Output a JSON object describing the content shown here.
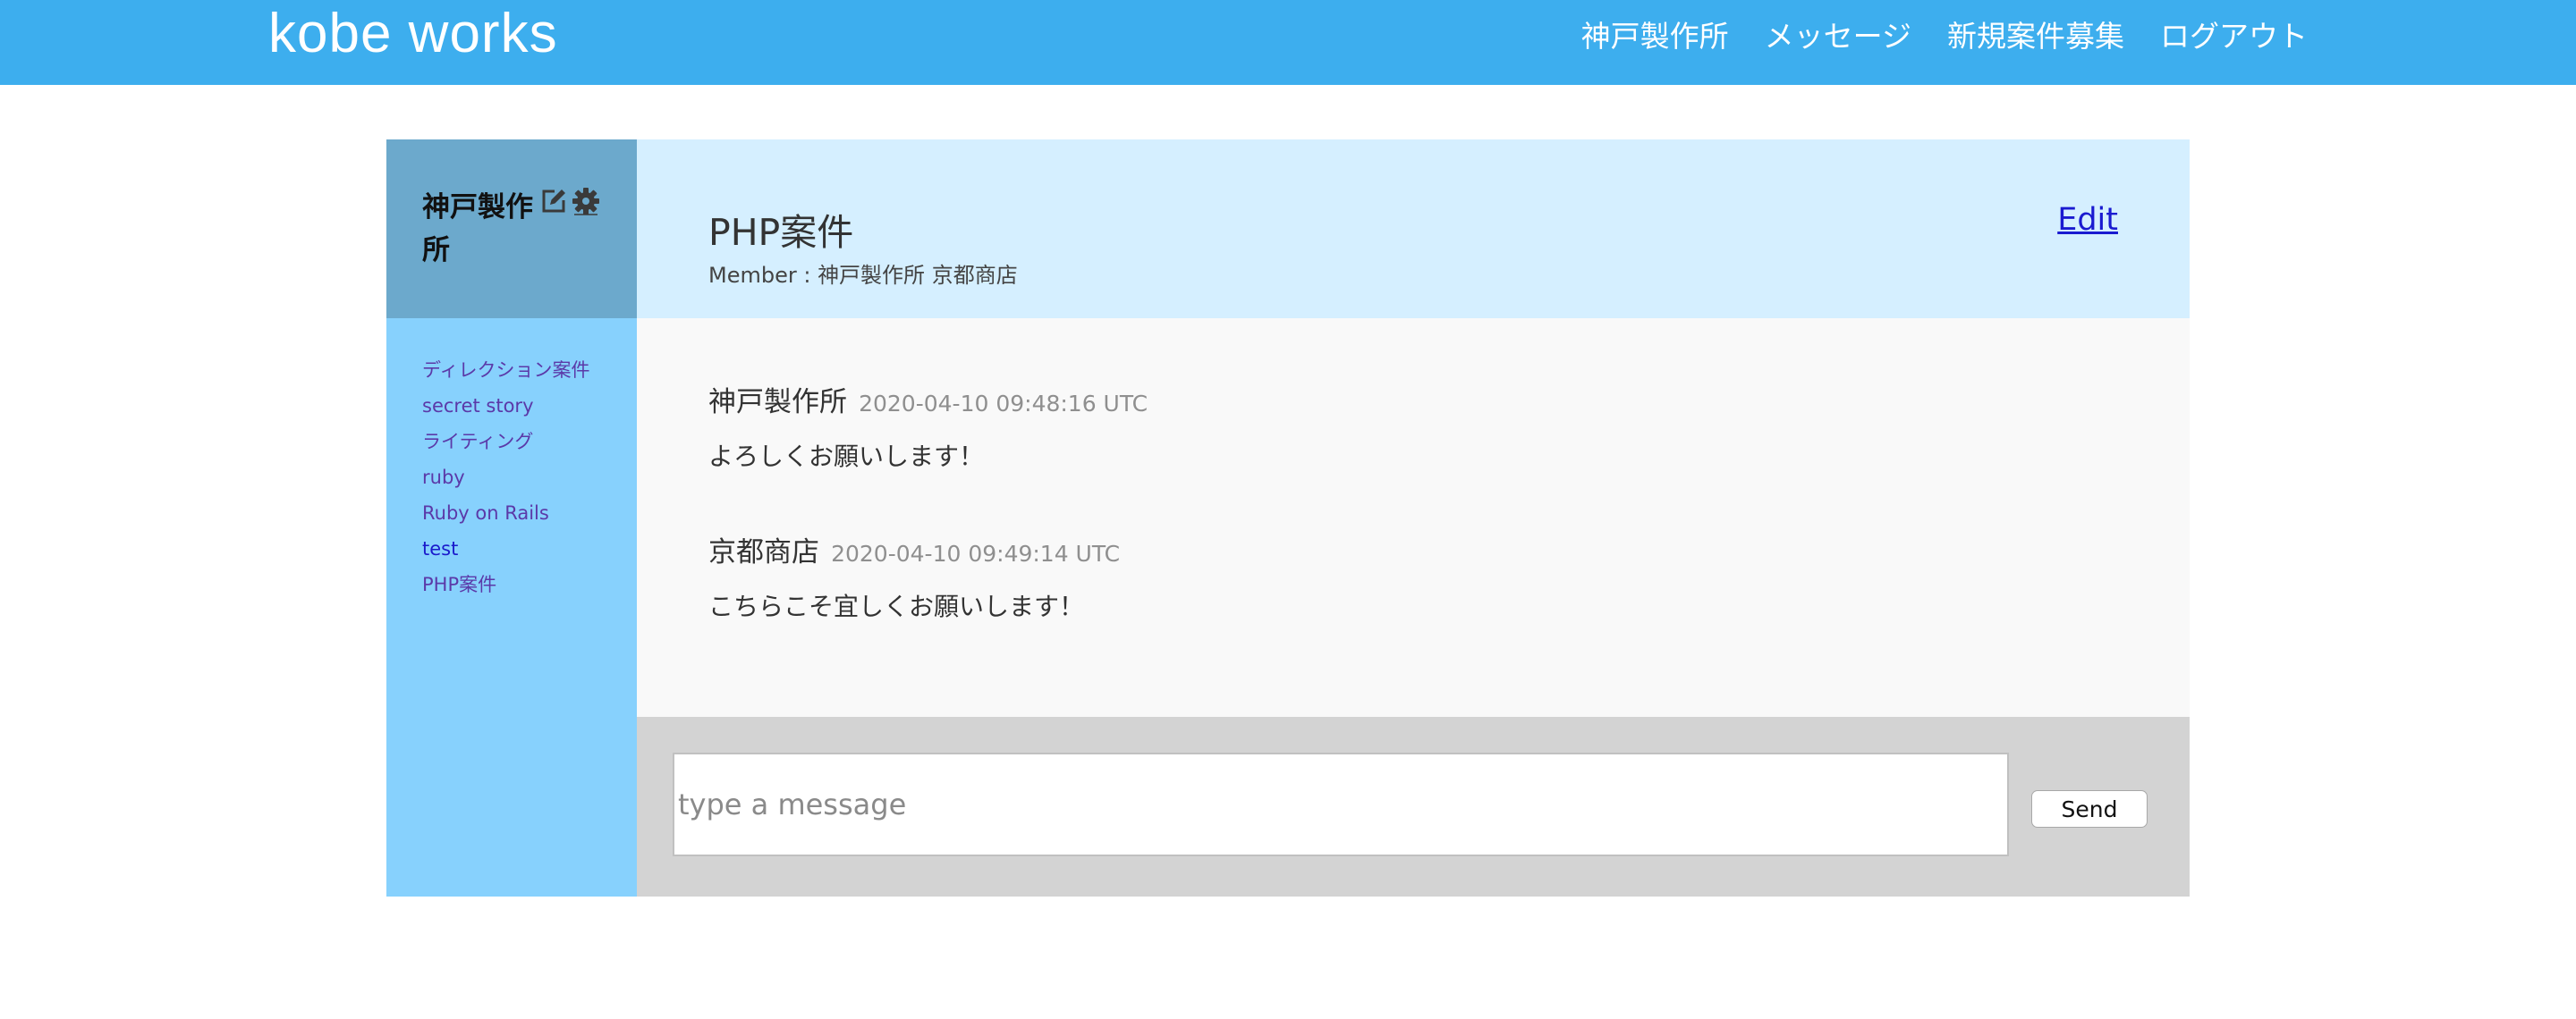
{
  "navbar": {
    "brand": "kobe works",
    "links": [
      "神戸製作所",
      "メッセージ",
      "新規案件募集",
      "ログアウト"
    ],
    "background": "#3daeee"
  },
  "sidebar": {
    "company_name": "神戸製作所",
    "icons": [
      "edit-icon",
      "gear-icon"
    ],
    "rooms": [
      "ディレクション案件",
      "secret story",
      "ライティング",
      "ruby",
      "Ruby on Rails",
      "test",
      "PHP案件"
    ],
    "active_room": "test"
  },
  "room": {
    "title": "PHP案件",
    "members": "Member : 神戸製作所 京都商店",
    "edit_label": "Edit"
  },
  "messages": [
    {
      "author": "神戸製作所",
      "time": "2020-04-10 09:48:16 UTC",
      "body": "よろしくお願いします！"
    },
    {
      "author": "京都商店",
      "time": "2020-04-10 09:49:14 UTC",
      "body": "こちらこそ宜しくお願いします！"
    }
  ],
  "composer": {
    "value": "",
    "placeholder": "type a message",
    "send_label": "Send"
  },
  "colors": {
    "sidebar": "#87d1fd",
    "sidebar_header": "#6ca9cc",
    "room_header": "#d5efff",
    "messages_bg": "#f9f9f9",
    "composer_bg": "#d3d3d3"
  }
}
